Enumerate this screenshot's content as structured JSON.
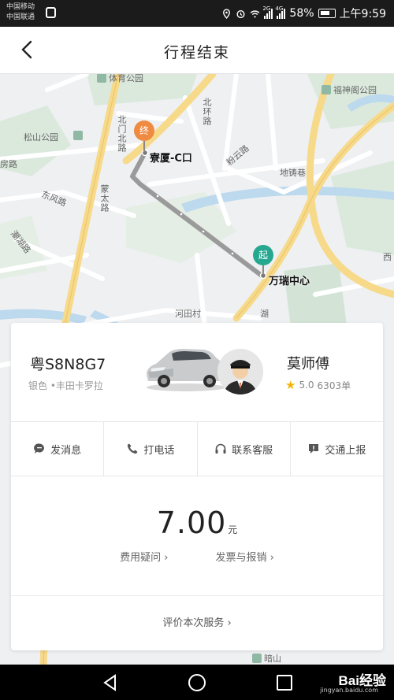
{
  "status_bar": {
    "carrier1": "中国移动",
    "carrier2": "中国联通",
    "network1": "2G",
    "network2": "4G",
    "battery": "58%",
    "time": "上午9:59"
  },
  "header": {
    "title": "行程结束"
  },
  "map": {
    "labels": {
      "tiyu_park": "体育公园",
      "songshan_park": "松山公园",
      "fushen_park": "福神阁公园",
      "beihuan_road": "北环路",
      "beili_road": "北门北路",
      "mengtai_road": "蒙太路",
      "dongfeng_road": "东风路",
      "chaohu_road": "潮湖路",
      "heyun_road": "粉云路",
      "fang_road": "房路",
      "ditu_road": "地铸巷",
      "hetian": "河田村",
      "west": "西",
      "hu": "湖",
      "anshan": "暗山"
    },
    "end_marker": "终",
    "start_marker": "起",
    "end_place": "寮厦-C口",
    "start_place": "万瑞中心"
  },
  "trip": {
    "plate": "粤S8N8G7",
    "car_desc": "银色 •丰田卡罗拉",
    "driver_name": "莫师傅",
    "rating": "5.0",
    "orders": "6303单"
  },
  "actions": [
    {
      "label": "发消息",
      "icon": "message-icon"
    },
    {
      "label": "打电话",
      "icon": "phone-icon"
    },
    {
      "label": "联系客服",
      "icon": "headset-icon"
    },
    {
      "label": "交通上报",
      "icon": "report-icon"
    }
  ],
  "fare": {
    "amount": "7.00",
    "unit": "元",
    "question_link": "费用疑问",
    "invoice_link": "发票与报销",
    "rate_service": "评价本次服务"
  },
  "watermark": {
    "main": "Bai经验",
    "sub": "jingyan.baidu.com"
  },
  "colors": {
    "end_marker": "#ef8a42",
    "start_marker": "#25a88f",
    "route": "#9a9a9a",
    "road_major": "#f7d98a",
    "star": "#f5b400"
  }
}
